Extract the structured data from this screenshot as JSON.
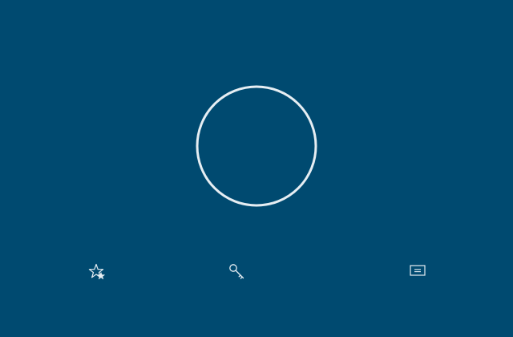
{
  "theme": {
    "background": "#004a70",
    "foreground": "#e6eef3"
  },
  "center_control": {
    "shape": "ring",
    "icon": "circle-ring",
    "label": ""
  },
  "bottom_bar": {
    "items": [
      {
        "icon": "star-favorites-icon",
        "label": ""
      },
      {
        "icon": "key-icon",
        "label": ""
      },
      {
        "icon": "id-card-icon",
        "label": ""
      }
    ]
  }
}
